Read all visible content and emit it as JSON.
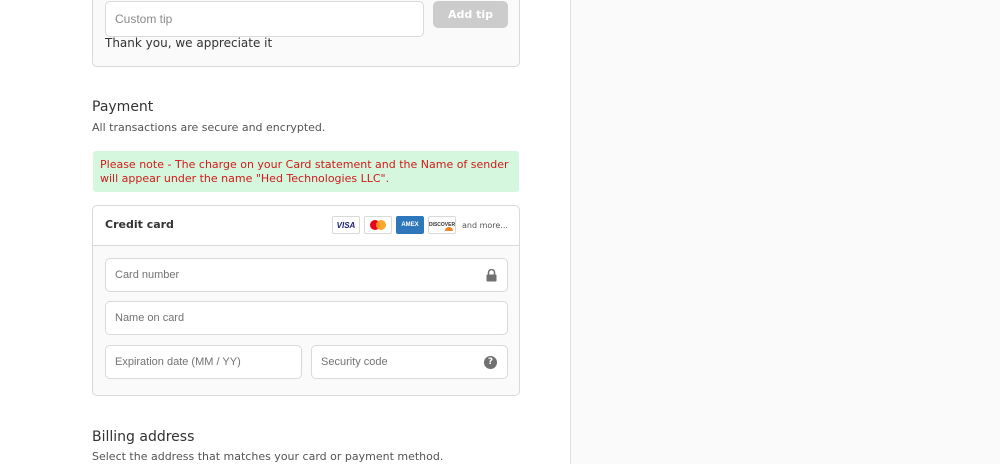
{
  "tip": {
    "custom_tip_placeholder": "Custom tip",
    "add_tip_label": "Add tip",
    "thanks_text": "Thank you, we appreciate it"
  },
  "payment": {
    "title": "Payment",
    "subtitle": "All transactions are secure and encrypted.",
    "notice": "Please note - The charge on your Card statement and the Name of sender will appear under the name \"Hed Technologies LLC\".",
    "notice_bg_color": "#d4f7dd",
    "notice_text_color": "#d21a1a",
    "credit_card": {
      "label": "Credit card",
      "logos": [
        {
          "name": "visa-logo",
          "text": "VISA"
        },
        {
          "name": "mastercard-logo",
          "text": ""
        },
        {
          "name": "amex-logo",
          "text": "AMEX"
        },
        {
          "name": "discover-logo",
          "text": "DISCOVER"
        }
      ],
      "and_more": "and more...",
      "card_number_placeholder": "Card number",
      "name_on_card_placeholder": "Name on card",
      "expiration_placeholder": "Expiration date (MM / YY)",
      "security_code_placeholder": "Security code",
      "security_help_glyph": "?"
    }
  },
  "billing": {
    "title": "Billing address",
    "subtitle": "Select the address that matches your card or payment method."
  }
}
